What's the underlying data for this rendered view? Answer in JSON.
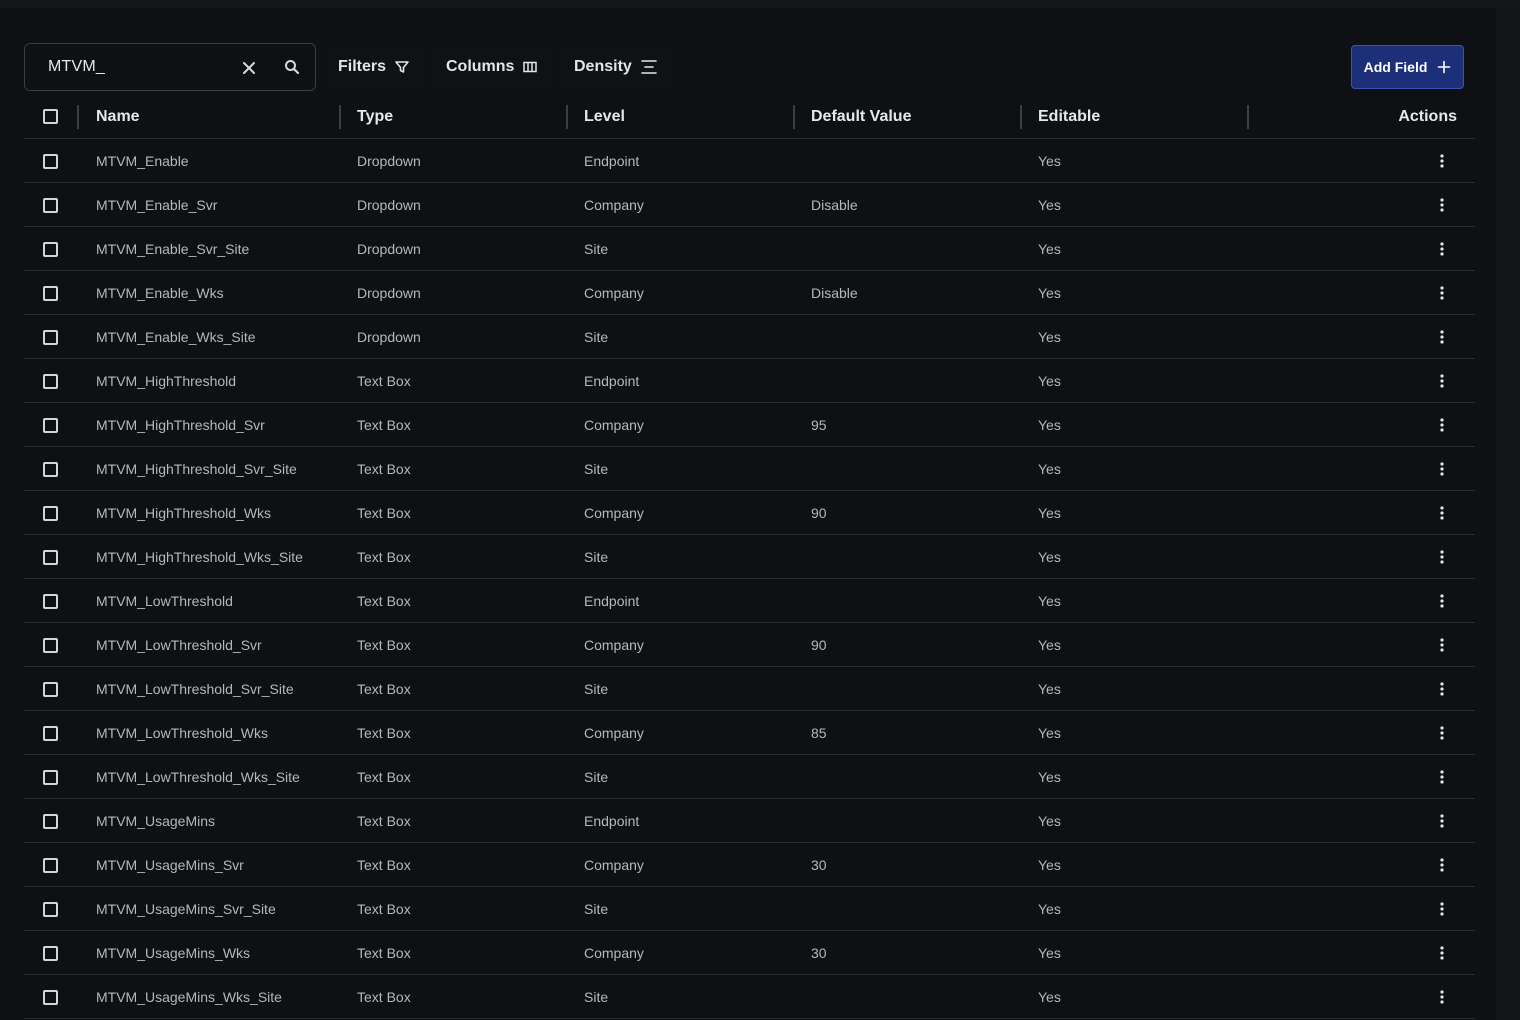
{
  "search": {
    "value": "MTVM_",
    "clear_icon": "close-icon",
    "search_icon": "search-icon"
  },
  "toolbar": {
    "filters_label": "Filters",
    "filters_icon": "filter-icon",
    "columns_label": "Columns",
    "columns_icon": "columns-icon",
    "density_label": "Density",
    "density_icon": "density-icon",
    "add_field_label": "Add Field",
    "add_field_icon": "plus-icon"
  },
  "colors": {
    "background": "#0e1013",
    "accent": "#1e2f7a",
    "text": "#b4b8be",
    "header_text": "#e6e8eb"
  },
  "table": {
    "headers": {
      "name": "Name",
      "type": "Type",
      "level": "Level",
      "default_value": "Default Value",
      "editable": "Editable",
      "actions": "Actions"
    },
    "rows": [
      {
        "name": "MTVM_Enable",
        "type": "Dropdown",
        "level": "Endpoint",
        "default_value": "",
        "editable": "Yes"
      },
      {
        "name": "MTVM_Enable_Svr",
        "type": "Dropdown",
        "level": "Company",
        "default_value": "Disable",
        "editable": "Yes"
      },
      {
        "name": "MTVM_Enable_Svr_Site",
        "type": "Dropdown",
        "level": "Site",
        "default_value": "",
        "editable": "Yes"
      },
      {
        "name": "MTVM_Enable_Wks",
        "type": "Dropdown",
        "level": "Company",
        "default_value": "Disable",
        "editable": "Yes"
      },
      {
        "name": "MTVM_Enable_Wks_Site",
        "type": "Dropdown",
        "level": "Site",
        "default_value": "",
        "editable": "Yes"
      },
      {
        "name": "MTVM_HighThreshold",
        "type": "Text Box",
        "level": "Endpoint",
        "default_value": "",
        "editable": "Yes"
      },
      {
        "name": "MTVM_HighThreshold_Svr",
        "type": "Text Box",
        "level": "Company",
        "default_value": "95",
        "editable": "Yes"
      },
      {
        "name": "MTVM_HighThreshold_Svr_Site",
        "type": "Text Box",
        "level": "Site",
        "default_value": "",
        "editable": "Yes"
      },
      {
        "name": "MTVM_HighThreshold_Wks",
        "type": "Text Box",
        "level": "Company",
        "default_value": "90",
        "editable": "Yes"
      },
      {
        "name": "MTVM_HighThreshold_Wks_Site",
        "type": "Text Box",
        "level": "Site",
        "default_value": "",
        "editable": "Yes"
      },
      {
        "name": "MTVM_LowThreshold",
        "type": "Text Box",
        "level": "Endpoint",
        "default_value": "",
        "editable": "Yes"
      },
      {
        "name": "MTVM_LowThreshold_Svr",
        "type": "Text Box",
        "level": "Company",
        "default_value": "90",
        "editable": "Yes"
      },
      {
        "name": "MTVM_LowThreshold_Svr_Site",
        "type": "Text Box",
        "level": "Site",
        "default_value": "",
        "editable": "Yes"
      },
      {
        "name": "MTVM_LowThreshold_Wks",
        "type": "Text Box",
        "level": "Company",
        "default_value": "85",
        "editable": "Yes"
      },
      {
        "name": "MTVM_LowThreshold_Wks_Site",
        "type": "Text Box",
        "level": "Site",
        "default_value": "",
        "editable": "Yes"
      },
      {
        "name": "MTVM_UsageMins",
        "type": "Text Box",
        "level": "Endpoint",
        "default_value": "",
        "editable": "Yes"
      },
      {
        "name": "MTVM_UsageMins_Svr",
        "type": "Text Box",
        "level": "Company",
        "default_value": "30",
        "editable": "Yes"
      },
      {
        "name": "MTVM_UsageMins_Svr_Site",
        "type": "Text Box",
        "level": "Site",
        "default_value": "",
        "editable": "Yes"
      },
      {
        "name": "MTVM_UsageMins_Wks",
        "type": "Text Box",
        "level": "Company",
        "default_value": "30",
        "editable": "Yes"
      },
      {
        "name": "MTVM_UsageMins_Wks_Site",
        "type": "Text Box",
        "level": "Site",
        "default_value": "",
        "editable": "Yes"
      }
    ]
  }
}
